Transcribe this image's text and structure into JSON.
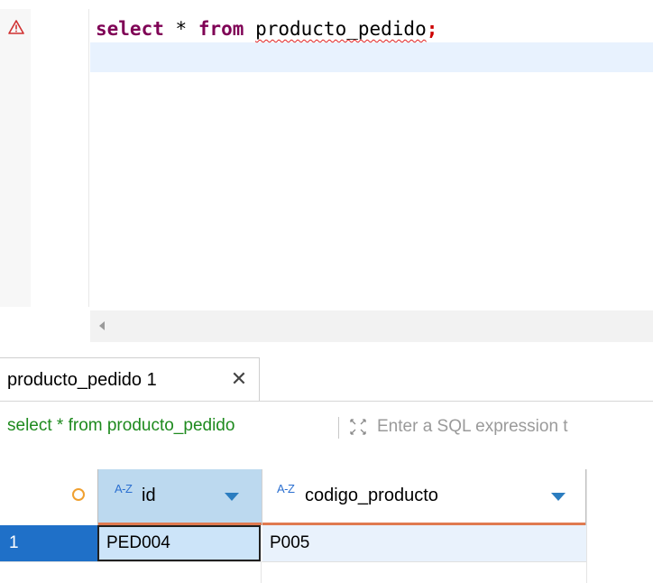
{
  "editor": {
    "keyword_select": "select",
    "star": "*",
    "keyword_from": "from",
    "table_name": "producto_pedido",
    "semicolon": ";"
  },
  "results": {
    "tab_label": "producto_pedido 1",
    "tab_close_glyph": "✕",
    "filter_query": "select * from producto_pedido",
    "filter_placeholder": "Enter a SQL expression t",
    "columns": [
      {
        "type_badge": "A-Z",
        "name": "id"
      },
      {
        "type_badge": "A-Z",
        "name": "codigo_producto"
      }
    ],
    "rows": [
      {
        "num": "1",
        "cells": [
          "PED004",
          "P005"
        ]
      }
    ]
  },
  "colors": {
    "keyword": "#7f0055",
    "filter_text": "#1e8a1e",
    "selected_row": "#1f70c8",
    "header_selected": "#bcd9ef"
  }
}
